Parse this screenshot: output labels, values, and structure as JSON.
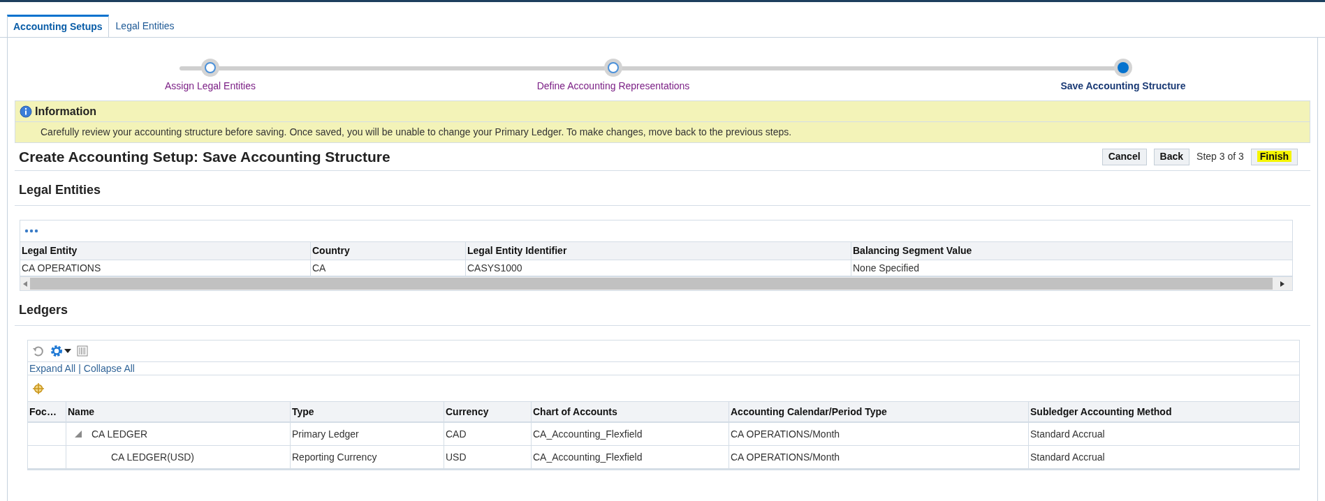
{
  "tabs": [
    {
      "label": "Accounting Setups",
      "selected": true
    },
    {
      "label": "Legal Entities",
      "selected": false
    }
  ],
  "train": [
    {
      "label": "Assign Legal Entities",
      "selected": false
    },
    {
      "label": "Define Accounting Representations",
      "selected": false
    },
    {
      "label": "Save Accounting Structure",
      "selected": true
    }
  ],
  "information": {
    "title": "Information",
    "message": "Carefully review your accounting structure before saving. Once saved, you will be unable to change your Primary Ledger. To make changes, move back to the previous steps."
  },
  "page_title": "Create Accounting Setup: Save Accounting Structure",
  "actions": {
    "cancel": "Cancel",
    "back": "Back",
    "step": "Step 3 of 3",
    "finish": "Finish"
  },
  "legal_entities": {
    "heading": "Legal Entities",
    "columns": [
      "Legal Entity",
      "Country",
      "Legal Entity Identifier",
      "Balancing Segment Value"
    ],
    "rows": [
      [
        "CA OPERATIONS",
        "CA",
        "CASYS1000",
        "None Specified"
      ]
    ]
  },
  "ledgers": {
    "heading": "Ledgers",
    "expand_all": "Expand All",
    "separator": "|",
    "collapse_all": "Collapse All",
    "columns": [
      "Foc…",
      "Name",
      "Type",
      "Currency",
      "Chart of Accounts",
      "Accounting Calendar/Period Type",
      "Subledger Accounting Method"
    ],
    "rows": [
      {
        "expanded": true,
        "cells": [
          "",
          "CA LEDGER",
          "Primary Ledger",
          "CAD",
          "CA_Accounting_Flexfield",
          "CA OPERATIONS/Month",
          "Standard Accrual"
        ],
        "children": [
          {
            "cells": [
              "",
              "CA LEDGER(USD)",
              "Reporting Currency",
              "USD",
              "CA_Accounting_Flexfield",
              "CA OPERATIONS/Month",
              "Standard Accrual"
            ]
          }
        ]
      }
    ]
  }
}
